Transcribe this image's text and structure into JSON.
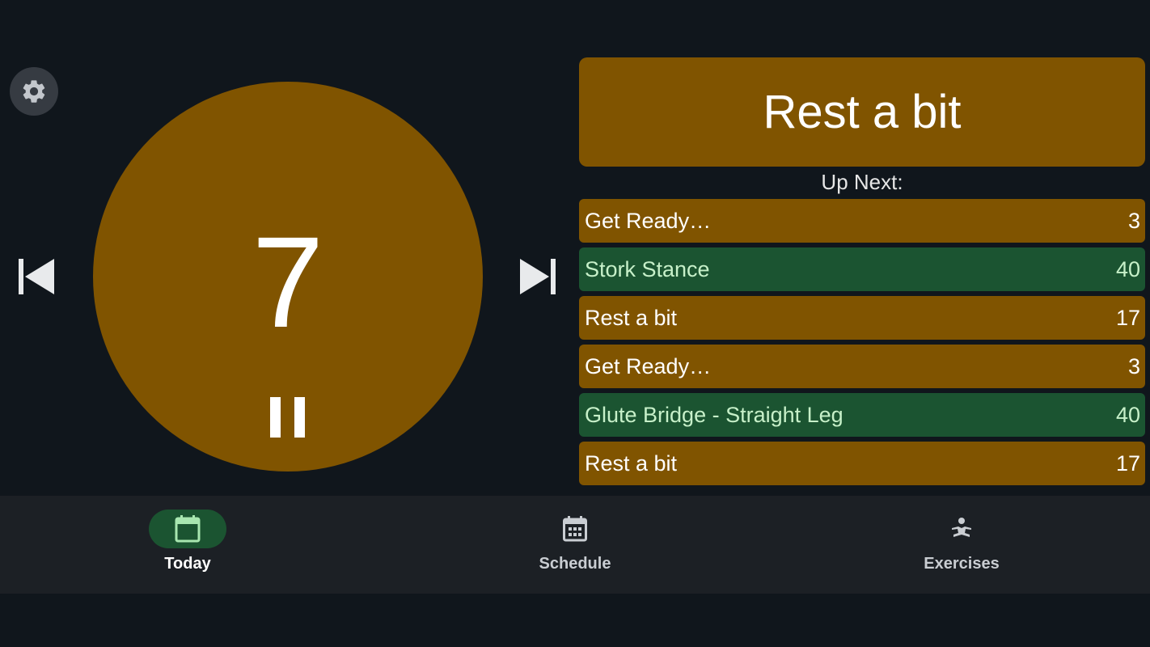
{
  "timer": {
    "value": "7"
  },
  "current": {
    "label": "Rest a bit"
  },
  "up_next": {
    "title": "Up Next:",
    "items": [
      {
        "name": "Get Ready…",
        "duration": "3",
        "kind": "rest"
      },
      {
        "name": "Stork Stance",
        "duration": "40",
        "kind": "work"
      },
      {
        "name": "Rest a bit",
        "duration": "17",
        "kind": "rest"
      },
      {
        "name": "Get Ready…",
        "duration": "3",
        "kind": "rest"
      },
      {
        "name": "Glute Bridge - Straight Leg",
        "duration": "40",
        "kind": "work"
      },
      {
        "name": "Rest a bit",
        "duration": "17",
        "kind": "rest"
      }
    ]
  },
  "nav": {
    "today": "Today",
    "schedule": "Schedule",
    "exercises": "Exercises"
  },
  "colors": {
    "background": "#10161c",
    "rest": "#805400",
    "work": "#1b5431",
    "work_text": "#c7f0c9",
    "navbar": "#1c2025"
  },
  "icons": {
    "settings": "gear-icon",
    "previous": "skip-previous-icon",
    "next": "skip-next-icon",
    "pause": "pause-icon",
    "today": "calendar-today-icon",
    "schedule": "calendar-month-icon",
    "exercises": "meditation-icon"
  }
}
